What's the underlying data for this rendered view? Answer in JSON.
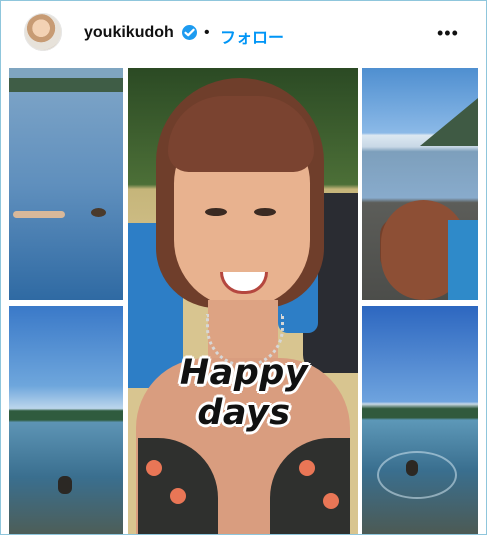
{
  "post": {
    "username": "youkikudoh",
    "separator": "•",
    "follow_label": "フォロー",
    "more_label": "•••",
    "overlay_text": "Happy days"
  },
  "icons": {
    "verified": "verified-badge-icon",
    "more": "more-options-icon"
  },
  "colors": {
    "accent": "#0095f6",
    "verified": "#1d9bf0"
  }
}
